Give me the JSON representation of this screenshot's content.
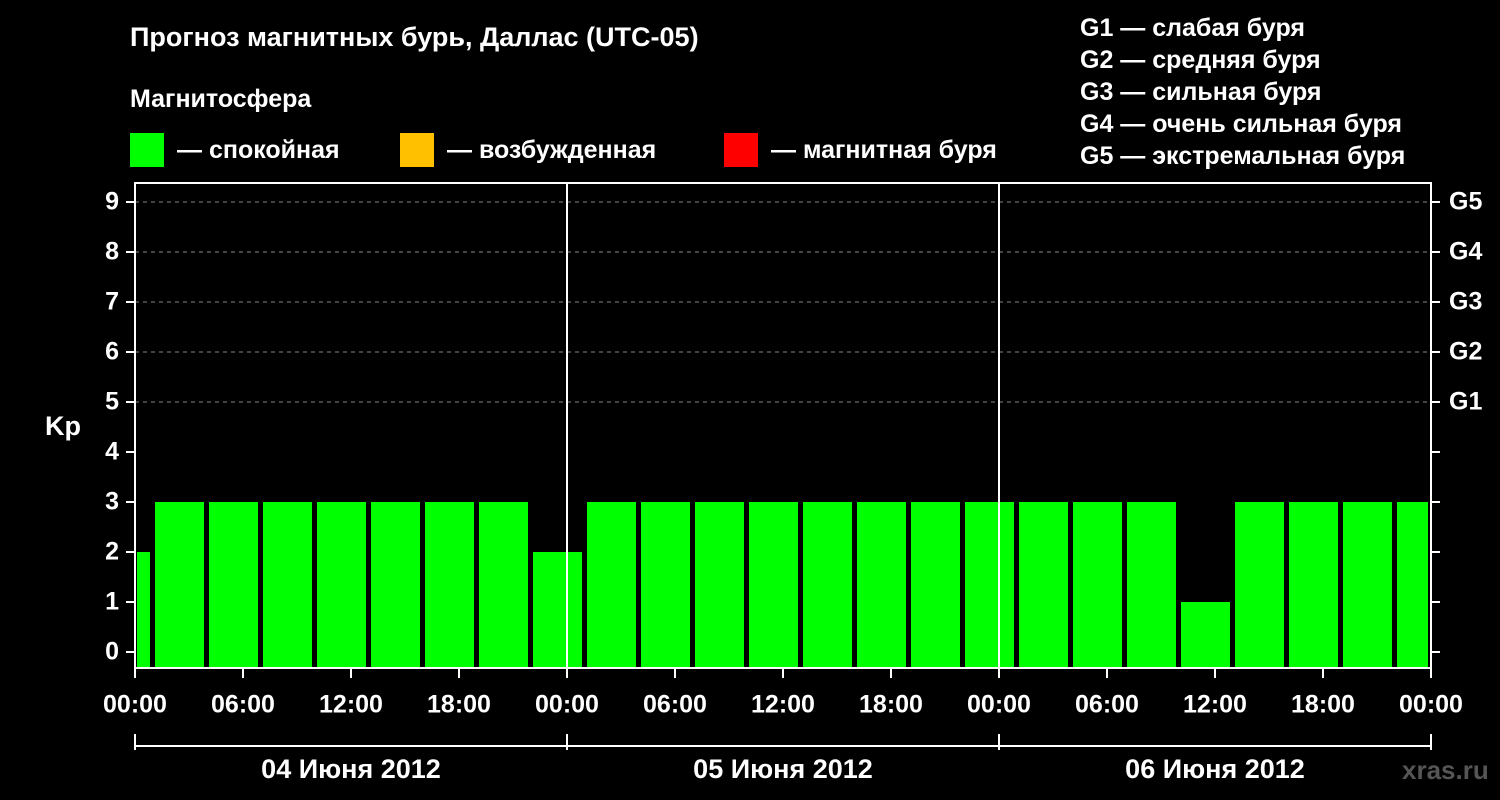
{
  "title": "Прогноз магнитных бурь, Даллас (UTC-05)",
  "subtitle": "Магнитосфера",
  "legend": [
    {
      "color": "#00ff00",
      "label": "— спокойная"
    },
    {
      "color": "#ffc000",
      "label": "— возбужденная"
    },
    {
      "color": "#ff0000",
      "label": "— магнитная буря"
    }
  ],
  "storm_levels": [
    "G1 — слабая буря",
    "G2 — средняя буря",
    "G3 — сильная буря",
    "G4 — очень сильная буря",
    "G5 — экстремальная буря"
  ],
  "watermark": "xras.ru",
  "colors": {
    "quiet": "#00ff00",
    "background": "#000000",
    "axis": "#ffffff",
    "grid": "#888888"
  },
  "chart_data": {
    "type": "bar",
    "ylabel": "Kp",
    "ylim": [
      0,
      9
    ],
    "yticks": [
      0,
      1,
      2,
      3,
      4,
      5,
      6,
      7,
      8,
      9
    ],
    "right_axis_labels": [
      {
        "kp": 5,
        "label": "G1"
      },
      {
        "kp": 6,
        "label": "G2"
      },
      {
        "kp": 7,
        "label": "G3"
      },
      {
        "kp": 8,
        "label": "G4"
      },
      {
        "kp": 9,
        "label": "G5"
      }
    ],
    "grid_dashed_levels": [
      5,
      6,
      7,
      8,
      9
    ],
    "x_tick_labels": [
      "00:00",
      "06:00",
      "12:00",
      "18:00",
      "00:00",
      "06:00",
      "12:00",
      "18:00",
      "00:00",
      "06:00",
      "12:00",
      "18:00",
      "00:00"
    ],
    "days": [
      "04 Июня 2012",
      "05 Июня 2012",
      "06 Июня 2012"
    ],
    "interval_hours": 3,
    "first_bar_hours": 1,
    "first_bar_value": 2,
    "values": [
      3,
      3,
      3,
      3,
      3,
      3,
      3,
      2,
      3,
      3,
      3,
      3,
      3,
      3,
      3,
      3,
      3,
      3,
      3,
      1,
      3,
      3,
      3,
      3
    ]
  }
}
